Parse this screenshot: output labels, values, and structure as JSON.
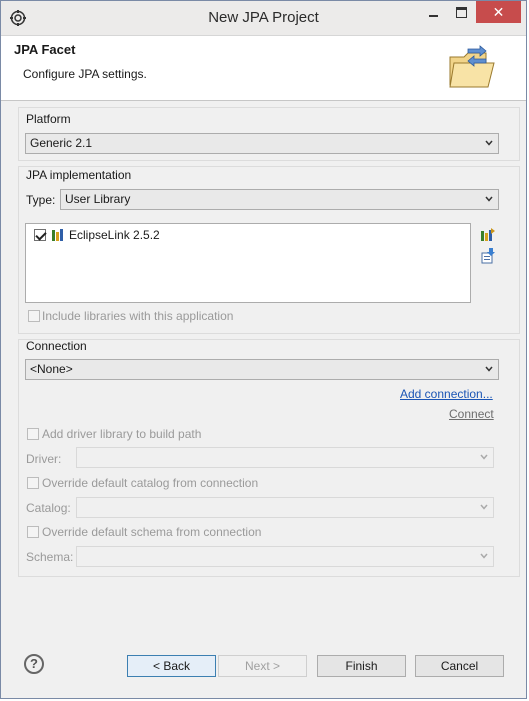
{
  "window": {
    "title": "New JPA Project",
    "close_glyph": "✕",
    "icons": [
      "app-icon",
      "minimize-icon",
      "maximize-icon",
      "close-icon"
    ]
  },
  "header": {
    "title": "JPA Facet",
    "subtitle": "Configure JPA settings.",
    "icon": "folder-wizard-icon"
  },
  "platform": {
    "label": "Platform",
    "selected": "Generic 2.1"
  },
  "jpa_implementation": {
    "label": "JPA implementation",
    "type_label": "Type:",
    "type_selected": "User Library",
    "libraries": [
      {
        "name": "EclipseLink 2.5.2",
        "checked": true
      }
    ],
    "include_libraries_label": "Include libraries with this application",
    "side_icons": [
      "manage-libraries-icon",
      "download-library-icon"
    ]
  },
  "connection": {
    "label": "Connection",
    "selected": "<None>",
    "add_connection_link": "Add connection...",
    "connect_link": "Connect",
    "add_driver_label": "Add driver library to build path",
    "driver_label": "Driver:",
    "override_catalog_label": "Override default catalog from connection",
    "catalog_label": "Catalog:",
    "override_schema_label": "Override default schema from connection",
    "schema_label": "Schema:"
  },
  "footer": {
    "help_glyph": "?",
    "back_label": "< Back",
    "next_label": "Next >",
    "finish_label": "Finish",
    "cancel_label": "Cancel"
  },
  "colors": {
    "close_red": "#c74c4c",
    "link_blue": "#1b55b5",
    "dialog_bg": "#f0f0f0"
  }
}
